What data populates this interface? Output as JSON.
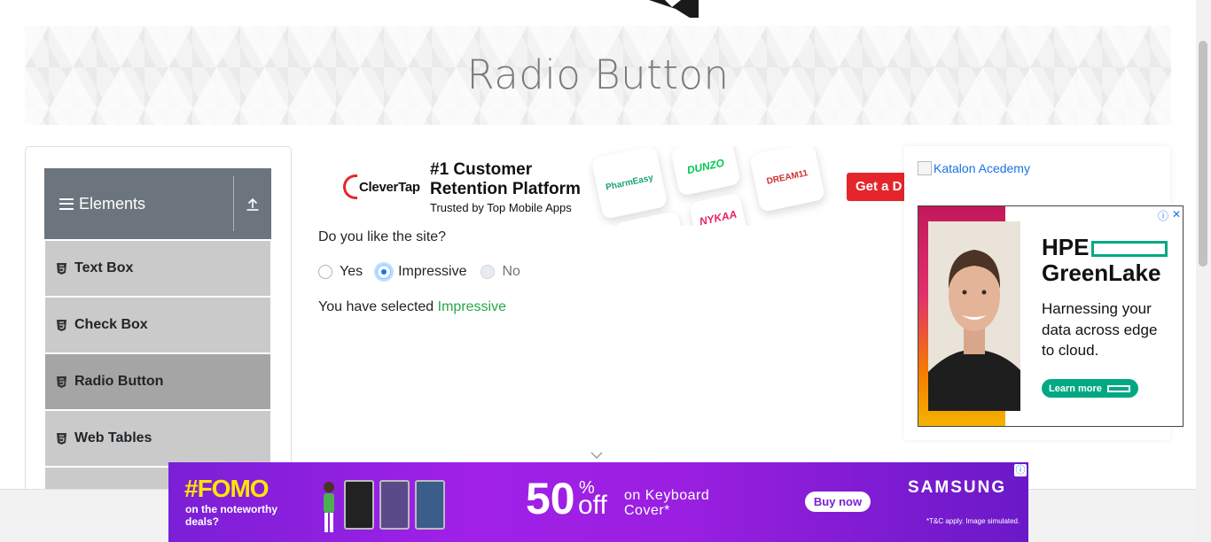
{
  "banner": {
    "title": "Radio Button"
  },
  "sidebar": {
    "group_title": "Elements",
    "items": [
      {
        "label": "Text Box"
      },
      {
        "label": "Check Box"
      },
      {
        "label": "Radio Button",
        "active": true
      },
      {
        "label": "Web Tables"
      }
    ]
  },
  "top_ad": {
    "brand": "CleverTap",
    "headline_line1": "#1 Customer",
    "headline_line2": "Retention Platform",
    "subline": "Trusted by Top Mobile Apps",
    "tiles": [
      "PharmEasy",
      "DUNZO",
      "DREAM11",
      "NYKAA"
    ],
    "cta": "Get a D"
  },
  "form": {
    "question": "Do you like the site?",
    "options": [
      {
        "label": "Yes",
        "checked": false,
        "disabled": false
      },
      {
        "label": "Impressive",
        "checked": true,
        "disabled": false
      },
      {
        "label": "No",
        "checked": false,
        "disabled": true
      }
    ],
    "result_prefix": "You have selected",
    "result_value": "Impressive"
  },
  "right": {
    "katalon_alt": "Katalon Acedemy",
    "hpe": {
      "logo_line1": "HPE",
      "logo_line2": "GreenLake",
      "text_line1": "Harnessing your",
      "text_line2": "data across edge",
      "text_line3": "to cloud.",
      "cta": "Learn more"
    }
  },
  "bottom_ad": {
    "fomo": "#FOMO",
    "fomo_sub_line1": "on the noteworthy",
    "fomo_sub_line2": "deals?",
    "percent": "50",
    "percent_sign": "%",
    "off": "off",
    "product_line1": "on Keyboard",
    "product_line2": "Cover*",
    "cta": "Buy now",
    "brand": "SAMSUNG",
    "disclaimer": "*T&C apply. Image simulated."
  },
  "colors": {
    "sidebar_header": "#6c757d",
    "menu_item": "#cacaca",
    "menu_active": "#a5a5a5",
    "success": "#28a745",
    "accent": "#007bff"
  }
}
